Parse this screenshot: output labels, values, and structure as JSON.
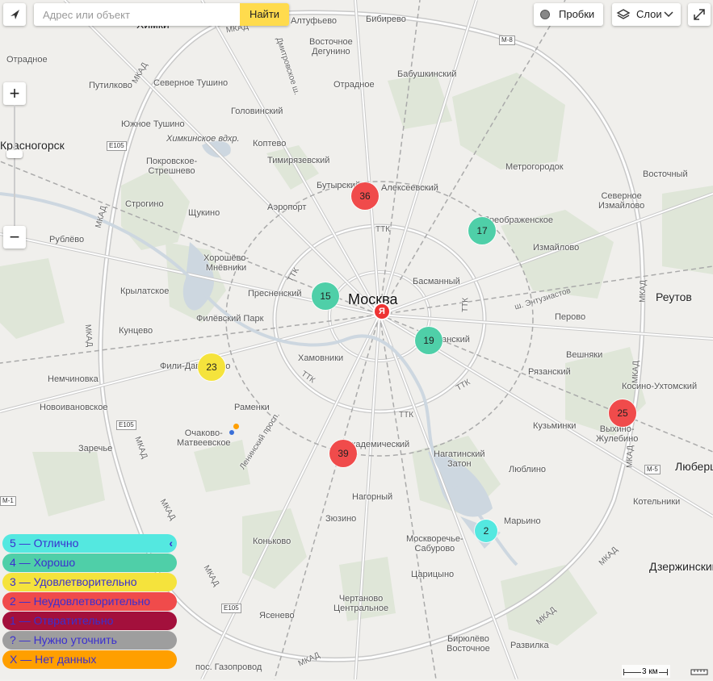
{
  "search": {
    "placeholder": "Адрес или объект",
    "button": "Найти"
  },
  "controls": {
    "traffic": "Пробки",
    "layers": "Слои",
    "zoom_in": "+",
    "zoom_out": "−"
  },
  "map_labels": {
    "moscow": "Москва",
    "khimki": "Химки",
    "krasnogorsk": "Красногорск",
    "reutov": "Реутов",
    "lyuber": "Люберцы",
    "dzerzh": "Дзержинский",
    "otradnoe1": "Отрадное",
    "otradnoe2": "Отрадное",
    "putilkovo": "Путилково",
    "sev_tushino": "Северное Тушино",
    "yuzh_tushino": "Южное Тушино",
    "golovinsky": "Головинский",
    "khimki_res": "Химкинское вдхр.",
    "koptevo": "Коптево",
    "pokrovskoe": "Покровское-\nСтрешнево",
    "timiryaz": "Тимирязевский",
    "butyrsky": "Бутырский",
    "alekseevsky": "Алексеевский",
    "strogino": "Строгино",
    "shchukino": "Щукино",
    "aeroport": "Аэропорт",
    "rublevo": "Рублёво",
    "khoroshevo": "Хорошёво-\nМнёвники",
    "krylatskoe": "Крылатское",
    "presnensky": "Пресненский",
    "filevsky": "Филёвский Парк",
    "kuntsevo": "Кунцево",
    "fili": "Фили-Давыдково",
    "khamovniki": "Хамовники",
    "nemchinovka": "Немчиновка",
    "novoivan": "Новоивановское",
    "ramenki": "Раменки",
    "ochakovo": "Очаково-\nМатвеевское",
    "zarechye": "Заречье",
    "leninsky": "Ленинский просп.",
    "akadem": "Академический",
    "nagorny": "Нагорный",
    "zyuzino": "Зюзино",
    "konkovo": "Коньково",
    "yasenevo": "Ясенево",
    "chertanovo": "Чертаново\nЦентральное",
    "tsaritsyno": "Царицыно",
    "moskvorech": "Москворечье-\nСабурово",
    "nagatino": "Нагатинский\nЗатон",
    "lyublino": "Люблино",
    "maryino": "Марьино",
    "biryulevo": "Бирюлёво\nВосточное",
    "razvilka": "Развилка",
    "gazoprovod": "пос. Газопровод",
    "kuzminki": "Кузьминки",
    "vykhino": "Выхино-\nЖулебино",
    "kotelniki": "Котельники",
    "ryazansky": "Рязанский",
    "veshnyaki": "Вешняки",
    "kosino": "Косино-Ухтомский",
    "perovo": "Перово",
    "izmailovo": "Измайлово",
    "sev_izm": "Северное\nИзмайлово",
    "preobr": "Преображенское",
    "metrogorodok": "Метрогородок",
    "vostochny": "Восточный",
    "basmanny": "Басманный",
    "tagansky": "Таганский",
    "entuziastov": "ш. Энтузиастов",
    "babushkin": "Бабушкинский",
    "bibirevo": "Бибирево",
    "vost_degunino": "Восточное\nДегунино",
    "altufyevo": "Алтуфьево",
    "dmitrovskoe": "Дмитровское ш.",
    "ttk1": "ТТК",
    "ttk2": "ТТК",
    "ttk3": "ТТК",
    "ttk4": "ТТК",
    "ttk5": "ТТК",
    "ttk6": "ТТК",
    "mkad1": "МКАД",
    "mkad2": "МКАД",
    "mkad3": "МКАД",
    "mkad4": "МКАД",
    "mkad5": "МКАД",
    "mkad6": "МКАД",
    "mkad7": "МКАД",
    "mkad8": "МКАД",
    "mkad9": "МКАД",
    "mkad10": "МКАД",
    "mkad11": "МКАД",
    "mkad12": "МКАД",
    "mkad13": "МКАД",
    "e105a": "E105",
    "e105b": "E105",
    "e105c": "E105",
    "m8": "M-8",
    "m5": "M-5",
    "m1": "M-1",
    "scale": "3 км"
  },
  "clusters": [
    {
      "count": "36",
      "color": "#f04b4b"
    },
    {
      "count": "17",
      "color": "#4fcfa8"
    },
    {
      "count": "15",
      "color": "#4fcfa8"
    },
    {
      "count": "19",
      "color": "#4fcfa8"
    },
    {
      "count": "23",
      "color": "#f5e33c"
    },
    {
      "count": "25",
      "color": "#f04b4b"
    },
    {
      "count": "39",
      "color": "#f04b4b"
    },
    {
      "count": "2",
      "color": "#54e8e0"
    }
  ],
  "legend": {
    "collapse_icon": "‹",
    "items": [
      {
        "label": "5 — Отлично",
        "color": "#54e8e0"
      },
      {
        "label": "4 — Хорошо",
        "color": "#4fcfa8"
      },
      {
        "label": "3 — Удовлетворительно",
        "color": "#f5e33c"
      },
      {
        "label": "2 — Неудовлетворительно",
        "color": "#f04b4b"
      },
      {
        "label": "1 — Отвратительно",
        "color": "#a3103c"
      },
      {
        "label": "? — Нужно уточнить",
        "color": "#9e9e9e"
      },
      {
        "label": "X — Нет данных",
        "color": "#ff9f00"
      }
    ]
  }
}
